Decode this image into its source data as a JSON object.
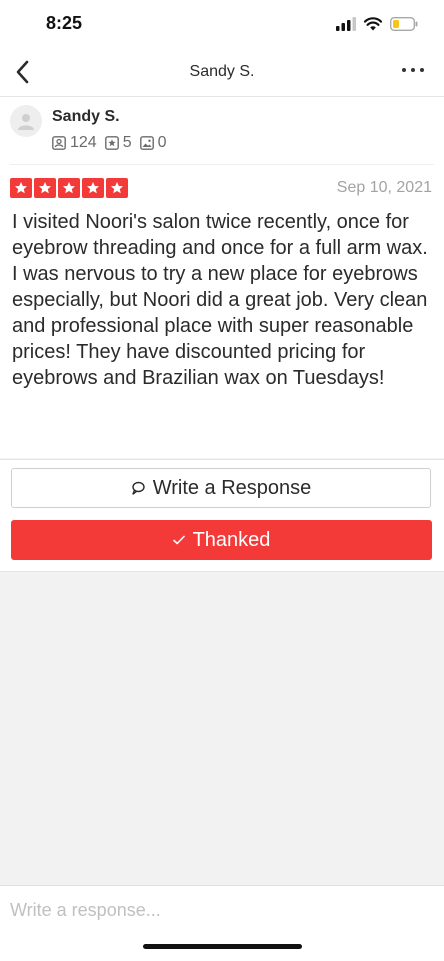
{
  "status_bar": {
    "time": "8:25"
  },
  "nav": {
    "title": "Sandy S."
  },
  "review": {
    "user_name": "Sandy S.",
    "stats": {
      "friends": "124",
      "reviews": "5",
      "photos": "0"
    },
    "rating": 5,
    "date": "Sep 10, 2021",
    "text": "I visited Noori's salon twice recently, once for eyebrow threading and once for a full arm wax. I was nervous to try a new place for eyebrows especially, but Noori did a great job. Very clean and professional place with super reasonable prices! They have discounted pricing for eyebrows and Brazilian wax on Tuesdays!"
  },
  "actions": {
    "write_response_label": "Write a Response",
    "thanked_label": "Thanked"
  },
  "compose": {
    "placeholder": "Write a response..."
  },
  "colors": {
    "accent": "#f43939",
    "text": "#2b2b2b",
    "muted": "#a3a3a3"
  },
  "icons": [
    "back-chevron-icon",
    "more-dots-icon",
    "avatar-placeholder-icon",
    "friends-icon",
    "reviews-star-icon",
    "photos-icon",
    "star-icon",
    "speech-bubble-icon",
    "checkmark-icon",
    "signal-icon",
    "wifi-icon",
    "battery-icon"
  ]
}
